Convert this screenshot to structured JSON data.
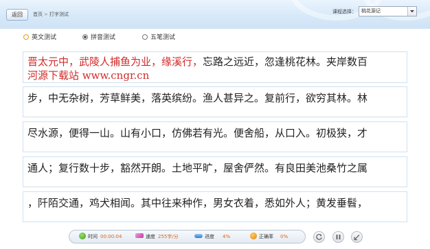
{
  "header": {
    "back_label": "返回",
    "breadcrumb": [
      "首页",
      "打字测试"
    ],
    "breadcrumb_sep": ">",
    "course_label": "课程选择：",
    "course_value": "桃花源记"
  },
  "modes": [
    {
      "label": "英文测试",
      "checked": false
    },
    {
      "label": "拼音测试",
      "checked": true
    },
    {
      "label": "五笔测试",
      "checked": false
    }
  ],
  "lines": [
    {
      "typed": "晋太元中，武陵人捕鱼为业，缘溪行，",
      "rest": "忘路之远近，忽逢桃花林。夹岸数百",
      "line2": "河源下载站 www.cngr.cn"
    },
    {
      "typed": "",
      "rest": "步，中无杂树，芳草鲜美，落英缤纷。渔人甚异之。复前行，欲穷其林。林",
      "line2": ""
    },
    {
      "typed": "",
      "rest": "尽水源，便得一山。山有小口，仿佛若有光。便舍船，从口入。初极狭，才",
      "line2": ""
    },
    {
      "typed": "",
      "rest": "通人；复行数十步，豁然开朗。土地平旷，屋舍俨然。有良田美池桑竹之属",
      "line2": ""
    },
    {
      "typed": "",
      "rest": "，阡陌交通，鸡犬相闻。其中往来种作，男女衣着，悉如外人；黄发垂髫，",
      "line2": ""
    }
  ],
  "status": {
    "time_label": "时间",
    "time_value": "00:00:04",
    "speed_label": "速度",
    "speed_value": "255字/分",
    "progress_label": "进度",
    "progress_value": "4%",
    "accuracy_label": "正确率",
    "accuracy_value": "0%"
  },
  "controls": {
    "restart_icon": "restart-icon",
    "pause_icon": "pause-icon",
    "exit_icon": "exit-icon"
  }
}
